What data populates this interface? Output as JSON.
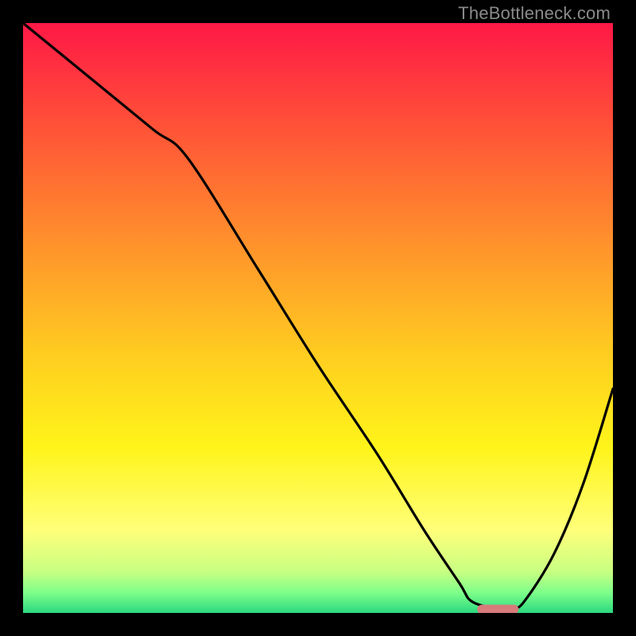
{
  "watermark": "TheBottleneck.com",
  "chart_data": {
    "type": "line",
    "title": "",
    "xlabel": "",
    "ylabel": "",
    "xlim": [
      0,
      100
    ],
    "ylim": [
      0,
      100
    ],
    "grid": false,
    "legend": false,
    "background_gradient": {
      "type": "vertical-rainbow-red-to-green",
      "stops": [
        {
          "pos": 0.0,
          "color": "#ff1846"
        },
        {
          "pos": 0.2,
          "color": "#ff5a36"
        },
        {
          "pos": 0.4,
          "color": "#ff9a2a"
        },
        {
          "pos": 0.58,
          "color": "#ffd21f"
        },
        {
          "pos": 0.72,
          "color": "#fff41a"
        },
        {
          "pos": 0.86,
          "color": "#ffff7a"
        },
        {
          "pos": 0.93,
          "color": "#c8ff82"
        },
        {
          "pos": 0.965,
          "color": "#7fff8a"
        },
        {
          "pos": 1.0,
          "color": "#2bd97f"
        }
      ]
    },
    "series": [
      {
        "name": "bottleneck-curve",
        "x": [
          0.0,
          11,
          22,
          28,
          40,
          50,
          60,
          68,
          74,
          76,
          80,
          83,
          85,
          90,
          95,
          100
        ],
        "y": [
          100,
          91,
          82,
          77,
          58,
          42,
          27,
          14,
          5,
          2,
          0.8,
          0.8,
          2,
          10,
          22,
          38
        ]
      }
    ],
    "markers": [
      {
        "name": "optimal-zone",
        "shape": "rounded-bar",
        "color": "#d77b7b",
        "x_start": 77,
        "x_end": 84,
        "y": 0.6,
        "height_pct": 1.6
      }
    ]
  }
}
